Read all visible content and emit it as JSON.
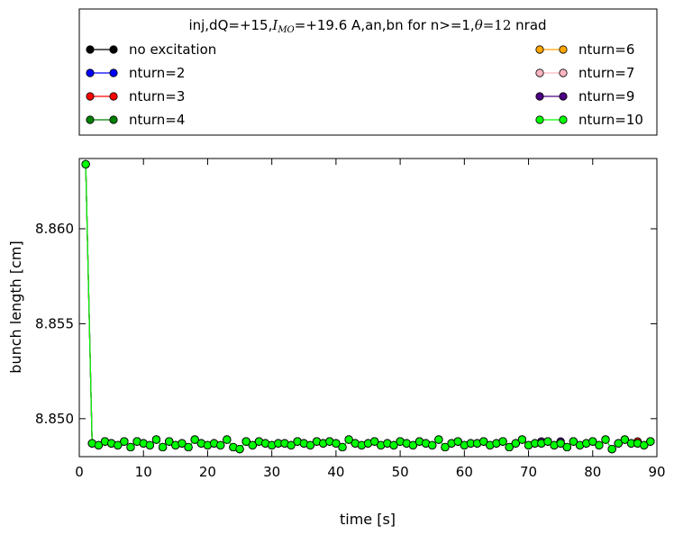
{
  "chart_data": {
    "type": "line",
    "legend_title": "inj,dQ=+15,I_MO=+19.6 A,an,bn for n>=1,θ=12 nrad",
    "legend_placement": "top, outside plot area, two columns",
    "xlabel": "time [s]",
    "ylabel": "bunch length [cm]",
    "xlim": [
      0,
      90
    ],
    "ylim": [
      8.848,
      8.8637
    ],
    "x_ticks": [
      "0",
      "10",
      "20",
      "30",
      "40",
      "50",
      "60",
      "70",
      "80",
      "90"
    ],
    "x_tick_values": [
      0,
      10,
      20,
      30,
      40,
      50,
      60,
      70,
      80,
      90
    ],
    "y_ticks": [
      "8.850",
      "8.855",
      "8.860"
    ],
    "y_tick_values": [
      8.85,
      8.855,
      8.86
    ],
    "grid": false,
    "x": [
      1,
      2,
      3,
      4,
      5,
      6,
      7,
      8,
      9,
      10,
      11,
      12,
      13,
      14,
      15,
      16,
      17,
      18,
      19,
      20,
      21,
      22,
      23,
      24,
      25,
      26,
      27,
      28,
      29,
      30,
      31,
      32,
      33,
      34,
      35,
      36,
      37,
      38,
      39,
      40,
      41,
      42,
      43,
      44,
      45,
      46,
      47,
      48,
      49,
      50,
      51,
      52,
      53,
      54,
      55,
      56,
      57,
      58,
      59,
      60,
      61,
      62,
      63,
      64,
      65,
      66,
      67,
      68,
      69,
      70,
      71,
      72,
      73,
      74,
      75,
      76,
      77,
      78,
      79,
      80,
      81,
      82,
      83,
      84,
      85,
      86,
      87,
      88,
      89
    ],
    "series": [
      {
        "name": "no excitation",
        "color": "#000000",
        "values": [
          8.8634,
          8.8487,
          8.8486,
          8.8488,
          8.8487,
          8.8486,
          8.8488,
          8.8485,
          8.8488,
          8.8487,
          8.8486,
          8.8489,
          8.8485,
          8.8488,
          8.8486,
          8.8487,
          8.8485,
          8.8489,
          8.8487,
          8.8486,
          8.8487,
          8.8486,
          8.8489,
          8.8485,
          8.8484,
          8.8488,
          8.8486,
          8.8488,
          8.8487,
          8.8486,
          8.8487,
          8.8487,
          8.8486,
          8.8488,
          8.8487,
          8.8486,
          8.8488,
          8.8487,
          8.8488,
          8.8487,
          8.8485,
          8.8489,
          8.8487,
          8.8486,
          8.8487,
          8.8488,
          8.8486,
          8.8487,
          8.8486,
          8.8488,
          8.8487,
          8.8486,
          8.8488,
          8.8487,
          8.8486,
          8.8489,
          8.8485,
          8.8487,
          8.8488,
          8.8486,
          8.8487,
          8.8487,
          8.8488,
          8.8486,
          8.8487,
          8.8488,
          8.8485,
          8.8487,
          8.8489,
          8.8486,
          8.8487,
          8.8487,
          8.8488,
          8.8486,
          8.8487,
          8.8485,
          8.8488,
          8.8486,
          8.8487,
          8.8488,
          8.8486,
          8.8489,
          8.8484,
          8.8487,
          8.8489,
          8.8487,
          8.8487,
          8.8486,
          8.8488
        ]
      },
      {
        "name": "nturn=2",
        "color": "#0000ff",
        "values": [
          8.8634,
          8.8487,
          8.8486,
          8.8488,
          8.8487,
          8.8486,
          8.8488,
          8.8485,
          8.8488,
          8.8487,
          8.8486,
          8.8489,
          8.8485,
          8.8488,
          8.8486,
          8.8487,
          8.8485,
          8.8489,
          8.8487,
          8.8486,
          8.8487,
          8.8486,
          8.8489,
          8.8485,
          8.8484,
          8.8488,
          8.8486,
          8.8488,
          8.8487,
          8.8486,
          8.8487,
          8.8487,
          8.8486,
          8.8488,
          8.8487,
          8.8486,
          8.8488,
          8.8487,
          8.8488,
          8.8487,
          8.8485,
          8.8489,
          8.8487,
          8.8486,
          8.8487,
          8.8488,
          8.8486,
          8.8487,
          8.8486,
          8.8488,
          8.8487,
          8.8486,
          8.8488,
          8.8487,
          8.8486,
          8.8489,
          8.8485,
          8.8487,
          8.8488,
          8.8486,
          8.8487,
          8.8487,
          8.8488,
          8.8486,
          8.8487,
          8.8488,
          8.8485,
          8.8487,
          8.8489,
          8.8486,
          8.8487,
          8.8487,
          8.8488,
          8.8486,
          8.8487,
          8.8485,
          8.8488,
          8.8486,
          8.8487,
          8.8488,
          8.8486,
          8.8489,
          8.8484,
          8.8487,
          8.8489,
          8.8487,
          8.8487,
          8.8486,
          8.8488
        ]
      },
      {
        "name": "nturn=3",
        "color": "#ff0000",
        "values": [
          8.8634,
          8.8487,
          8.8486,
          8.8488,
          8.8487,
          8.8486,
          8.8488,
          8.8485,
          8.8488,
          8.8487,
          8.8486,
          8.8489,
          8.8485,
          8.8488,
          8.8486,
          8.8487,
          8.8485,
          8.8489,
          8.8487,
          8.8486,
          8.8487,
          8.8486,
          8.8489,
          8.8485,
          8.8484,
          8.8488,
          8.8486,
          8.8488,
          8.8487,
          8.8486,
          8.8487,
          8.8487,
          8.8486,
          8.8488,
          8.8487,
          8.8486,
          8.8488,
          8.8487,
          8.8488,
          8.8487,
          8.8485,
          8.8489,
          8.8487,
          8.8486,
          8.8487,
          8.8488,
          8.8486,
          8.8487,
          8.8486,
          8.8488,
          8.8487,
          8.8486,
          8.8488,
          8.8487,
          8.8486,
          8.8489,
          8.8485,
          8.8487,
          8.8488,
          8.8486,
          8.8487,
          8.8487,
          8.8488,
          8.8486,
          8.8487,
          8.8488,
          8.8485,
          8.8487,
          8.8489,
          8.8486,
          8.8487,
          8.8487,
          8.8488,
          8.8486,
          8.8487,
          8.8485,
          8.8488,
          8.8486,
          8.8487,
          8.8488,
          8.8486,
          8.8489,
          8.8484,
          8.8487,
          8.8489,
          8.8487,
          8.8488,
          8.8486,
          8.8488
        ]
      },
      {
        "name": "nturn=4",
        "color": "#008000",
        "values": [
          8.8634,
          8.8487,
          8.8486,
          8.8488,
          8.8487,
          8.8486,
          8.8488,
          8.8485,
          8.8488,
          8.8487,
          8.8486,
          8.8489,
          8.8485,
          8.8488,
          8.8486,
          8.8487,
          8.8485,
          8.8489,
          8.8487,
          8.8486,
          8.8487,
          8.8486,
          8.8489,
          8.8485,
          8.8484,
          8.8488,
          8.8486,
          8.8488,
          8.8487,
          8.8486,
          8.8487,
          8.8487,
          8.8486,
          8.8488,
          8.8487,
          8.8486,
          8.8488,
          8.8487,
          8.8488,
          8.8487,
          8.8485,
          8.8489,
          8.8487,
          8.8486,
          8.8487,
          8.8488,
          8.8486,
          8.8487,
          8.8486,
          8.8488,
          8.8487,
          8.8486,
          8.8488,
          8.8487,
          8.8486,
          8.8489,
          8.8485,
          8.8487,
          8.8488,
          8.8486,
          8.8487,
          8.8487,
          8.8488,
          8.8486,
          8.8487,
          8.8488,
          8.8485,
          8.8487,
          8.8489,
          8.8486,
          8.8487,
          8.8487,
          8.8488,
          8.8486,
          8.8487,
          8.8485,
          8.8488,
          8.8486,
          8.8487,
          8.8488,
          8.8486,
          8.8489,
          8.8484,
          8.8487,
          8.8489,
          8.8487,
          8.8487,
          8.8486,
          8.8488
        ]
      },
      {
        "name": "nturn=6",
        "color": "#ffa500",
        "values": [
          8.8634,
          8.8487,
          8.8486,
          8.8488,
          8.8487,
          8.8486,
          8.8488,
          8.8485,
          8.8488,
          8.8487,
          8.8486,
          8.8489,
          8.8485,
          8.8488,
          8.8486,
          8.8487,
          8.8485,
          8.8489,
          8.8487,
          8.8486,
          8.8487,
          8.8486,
          8.8489,
          8.8485,
          8.8484,
          8.8488,
          8.8486,
          8.8488,
          8.8487,
          8.8486,
          8.8487,
          8.8487,
          8.8486,
          8.8488,
          8.8487,
          8.8486,
          8.8488,
          8.8487,
          8.8488,
          8.8487,
          8.8485,
          8.8489,
          8.8487,
          8.8486,
          8.8487,
          8.8488,
          8.8486,
          8.8487,
          8.8486,
          8.8488,
          8.8487,
          8.8486,
          8.8488,
          8.8487,
          8.8486,
          8.8489,
          8.8485,
          8.8487,
          8.8488,
          8.8486,
          8.8487,
          8.8487,
          8.8488,
          8.8486,
          8.8487,
          8.8488,
          8.8485,
          8.8487,
          8.8489,
          8.8486,
          8.8487,
          8.8487,
          8.8488,
          8.8486,
          8.8487,
          8.8485,
          8.8488,
          8.8486,
          8.8487,
          8.8488,
          8.8486,
          8.8489,
          8.8484,
          8.8487,
          8.8489,
          8.8487,
          8.8487,
          8.8486,
          8.8488
        ]
      },
      {
        "name": "nturn=7",
        "color": "#ffb6c1",
        "values": [
          8.8634,
          8.8487,
          8.8486,
          8.8488,
          8.8487,
          8.8486,
          8.8488,
          8.8485,
          8.8488,
          8.8487,
          8.8486,
          8.8489,
          8.8485,
          8.8488,
          8.8486,
          8.8487,
          8.8485,
          8.8489,
          8.8487,
          8.8486,
          8.8487,
          8.8486,
          8.8489,
          8.8485,
          8.8484,
          8.8488,
          8.8486,
          8.8488,
          8.8487,
          8.8486,
          8.8487,
          8.8487,
          8.8486,
          8.8488,
          8.8487,
          8.8486,
          8.8488,
          8.8487,
          8.8488,
          8.8487,
          8.8485,
          8.8489,
          8.8487,
          8.8486,
          8.8487,
          8.8488,
          8.8486,
          8.8487,
          8.8486,
          8.8488,
          8.8487,
          8.8486,
          8.8488,
          8.8487,
          8.8486,
          8.8489,
          8.8485,
          8.8487,
          8.8488,
          8.8486,
          8.8487,
          8.8487,
          8.8488,
          8.8486,
          8.8487,
          8.8488,
          8.8485,
          8.8487,
          8.8489,
          8.8486,
          8.8487,
          8.8487,
          8.8488,
          8.8486,
          8.8487,
          8.8485,
          8.8488,
          8.8486,
          8.8487,
          8.8488,
          8.8486,
          8.8489,
          8.8484,
          8.8487,
          8.8489,
          8.8487,
          8.8487,
          8.8486,
          8.8488
        ]
      },
      {
        "name": "nturn=9",
        "color": "#4b0082",
        "values": [
          8.8634,
          8.8487,
          8.8486,
          8.8488,
          8.8487,
          8.8486,
          8.8488,
          8.8485,
          8.8488,
          8.8487,
          8.8486,
          8.8489,
          8.8485,
          8.8488,
          8.8486,
          8.8487,
          8.8485,
          8.8489,
          8.8487,
          8.8486,
          8.8487,
          8.8486,
          8.8489,
          8.8485,
          8.8484,
          8.8488,
          8.8486,
          8.8488,
          8.8487,
          8.8486,
          8.8487,
          8.8487,
          8.8486,
          8.8488,
          8.8487,
          8.8486,
          8.8488,
          8.8487,
          8.8488,
          8.8487,
          8.8485,
          8.8489,
          8.8487,
          8.8486,
          8.8487,
          8.8488,
          8.8486,
          8.8487,
          8.8486,
          8.8488,
          8.8487,
          8.8486,
          8.8488,
          8.8487,
          8.8486,
          8.8489,
          8.8485,
          8.8487,
          8.8488,
          8.8486,
          8.8487,
          8.8487,
          8.8488,
          8.8486,
          8.8487,
          8.8488,
          8.8485,
          8.8487,
          8.8489,
          8.8486,
          8.8487,
          8.8488,
          8.8488,
          8.8486,
          8.8488,
          8.8485,
          8.8488,
          8.8486,
          8.8487,
          8.8488,
          8.8486,
          8.8489,
          8.8484,
          8.8487,
          8.8489,
          8.8487,
          8.8487,
          8.8486,
          8.8488
        ]
      },
      {
        "name": "nturn=10",
        "color": "#00ff00",
        "values": [
          8.8634,
          8.8487,
          8.8486,
          8.8488,
          8.8487,
          8.8486,
          8.8488,
          8.8485,
          8.8488,
          8.8487,
          8.8486,
          8.8489,
          8.8485,
          8.8488,
          8.8486,
          8.8487,
          8.8485,
          8.8489,
          8.8487,
          8.8486,
          8.8487,
          8.8486,
          8.8489,
          8.8485,
          8.8484,
          8.8488,
          8.8486,
          8.8488,
          8.8487,
          8.8486,
          8.8487,
          8.8487,
          8.8486,
          8.8488,
          8.8487,
          8.8486,
          8.8488,
          8.8487,
          8.8488,
          8.8487,
          8.8485,
          8.8489,
          8.8487,
          8.8486,
          8.8487,
          8.8488,
          8.8486,
          8.8487,
          8.8486,
          8.8488,
          8.8487,
          8.8486,
          8.8488,
          8.8487,
          8.8486,
          8.8489,
          8.8485,
          8.8487,
          8.8488,
          8.8486,
          8.8487,
          8.8487,
          8.8488,
          8.8486,
          8.8487,
          8.8488,
          8.8485,
          8.8487,
          8.8489,
          8.8486,
          8.8487,
          8.8487,
          8.8488,
          8.8486,
          8.8487,
          8.8485,
          8.8488,
          8.8486,
          8.8487,
          8.8488,
          8.8486,
          8.8489,
          8.8484,
          8.8487,
          8.8489,
          8.8487,
          8.8487,
          8.8486,
          8.8488
        ]
      }
    ]
  }
}
